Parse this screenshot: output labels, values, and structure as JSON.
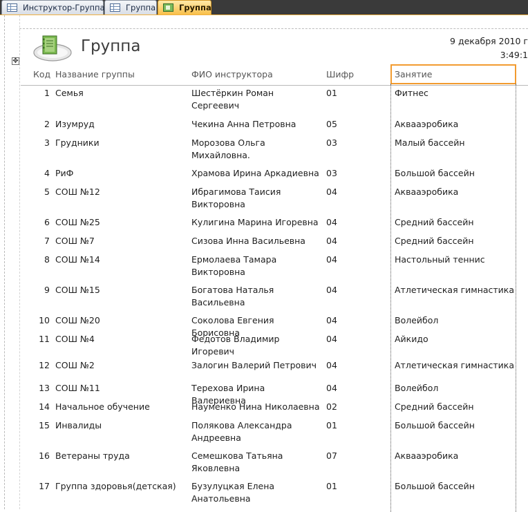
{
  "tabs": [
    {
      "label": "Инструктор-Группа",
      "icon": "table-icon",
      "active": false
    },
    {
      "label": "Группа",
      "icon": "table-icon",
      "active": false
    },
    {
      "label": "Группа",
      "icon": "report-icon",
      "active": true
    }
  ],
  "report": {
    "title": "Группа",
    "date": "9 декабря 2010 г",
    "time": "3:49:1",
    "logo_icon": "notebook-report-icon",
    "layout_handle_glyph": "✥"
  },
  "columns": {
    "id": "Код",
    "name": "Название группы",
    "instructor": "ФИО инструктора",
    "code": "Шифр",
    "activity": "Занятие"
  },
  "rows": [
    {
      "id": "1",
      "name": "Семья",
      "instructor": "Шестёркин Роман Сергеевич",
      "code": "01",
      "activity": "Фитнес"
    },
    {
      "id": "2",
      "name": "Изумруд",
      "instructor": "Чекина Анна Петровна",
      "code": "05",
      "activity": "Аквааэробика"
    },
    {
      "id": "3",
      "name": "Грудники",
      "instructor": "Морозова Ольга Михайловна.",
      "code": "03",
      "activity": "Малый бассейн"
    },
    {
      "id": "4",
      "name": "РиФ",
      "instructor": "Храмова Ирина Аркадиевна",
      "code": "03",
      "activity": "Большой бассейн"
    },
    {
      "id": "5",
      "name": "СОШ №12",
      "instructor": "Ибрагимова Таисия Викторовна",
      "code": "04",
      "activity": "Аквааэробика"
    },
    {
      "id": "6",
      "name": "СОШ №25",
      "instructor": "Кулигина Марина Игоревна",
      "code": "04",
      "activity": "Средний бассейн"
    },
    {
      "id": "7",
      "name": "СОШ №7",
      "instructor": "Сизова Инна Васильевна",
      "code": "04",
      "activity": "Средний бассейн"
    },
    {
      "id": "8",
      "name": "СОШ №14",
      "instructor": "Ермолаева Тамара Викторовна",
      "code": "04",
      "activity": "Настольный теннис"
    },
    {
      "id": "9",
      "name": "СОШ №15",
      "instructor": "Богатова Наталья Васильевна",
      "code": "04",
      "activity": "Атлетическая гимнастика"
    },
    {
      "id": "10",
      "name": "СОШ №20",
      "instructor": "Соколова Евгения Борисовна",
      "code": "04",
      "activity": "Волейбол"
    },
    {
      "id": "11",
      "name": "СОШ №4",
      "instructor": "Федотов Владимир Игоревич",
      "code": "04",
      "activity": "Айкидо"
    },
    {
      "id": "12",
      "name": "СОШ №2",
      "instructor": "Залогин  Валерий Петрович",
      "code": "04",
      "activity": "Атлетическая гимнастика"
    },
    {
      "id": "13",
      "name": "СОШ №11",
      "instructor": "Терехова Ирина Валериевна",
      "code": "04",
      "activity": "Волейбол"
    },
    {
      "id": "14",
      "name": "Начальное обучение",
      "instructor": "Науменко Нина Николаевна",
      "code": "02",
      "activity": "Средний бассейн"
    },
    {
      "id": "15",
      "name": "Инвалиды",
      "instructor": "Полякова Александра Андреевна",
      "code": "01",
      "activity": "Большой бассейн"
    },
    {
      "id": "16",
      "name": "Ветераны труда",
      "instructor": "Семешкова Татьяна Яковлевна",
      "code": "07",
      "activity": "Аквааэробика"
    },
    {
      "id": "17",
      "name": "Группа здоровья(детская)",
      "instructor": "Бузулуцкая Елена Анатольевна",
      "code": "01",
      "activity": "Большой бассейн"
    }
  ]
}
